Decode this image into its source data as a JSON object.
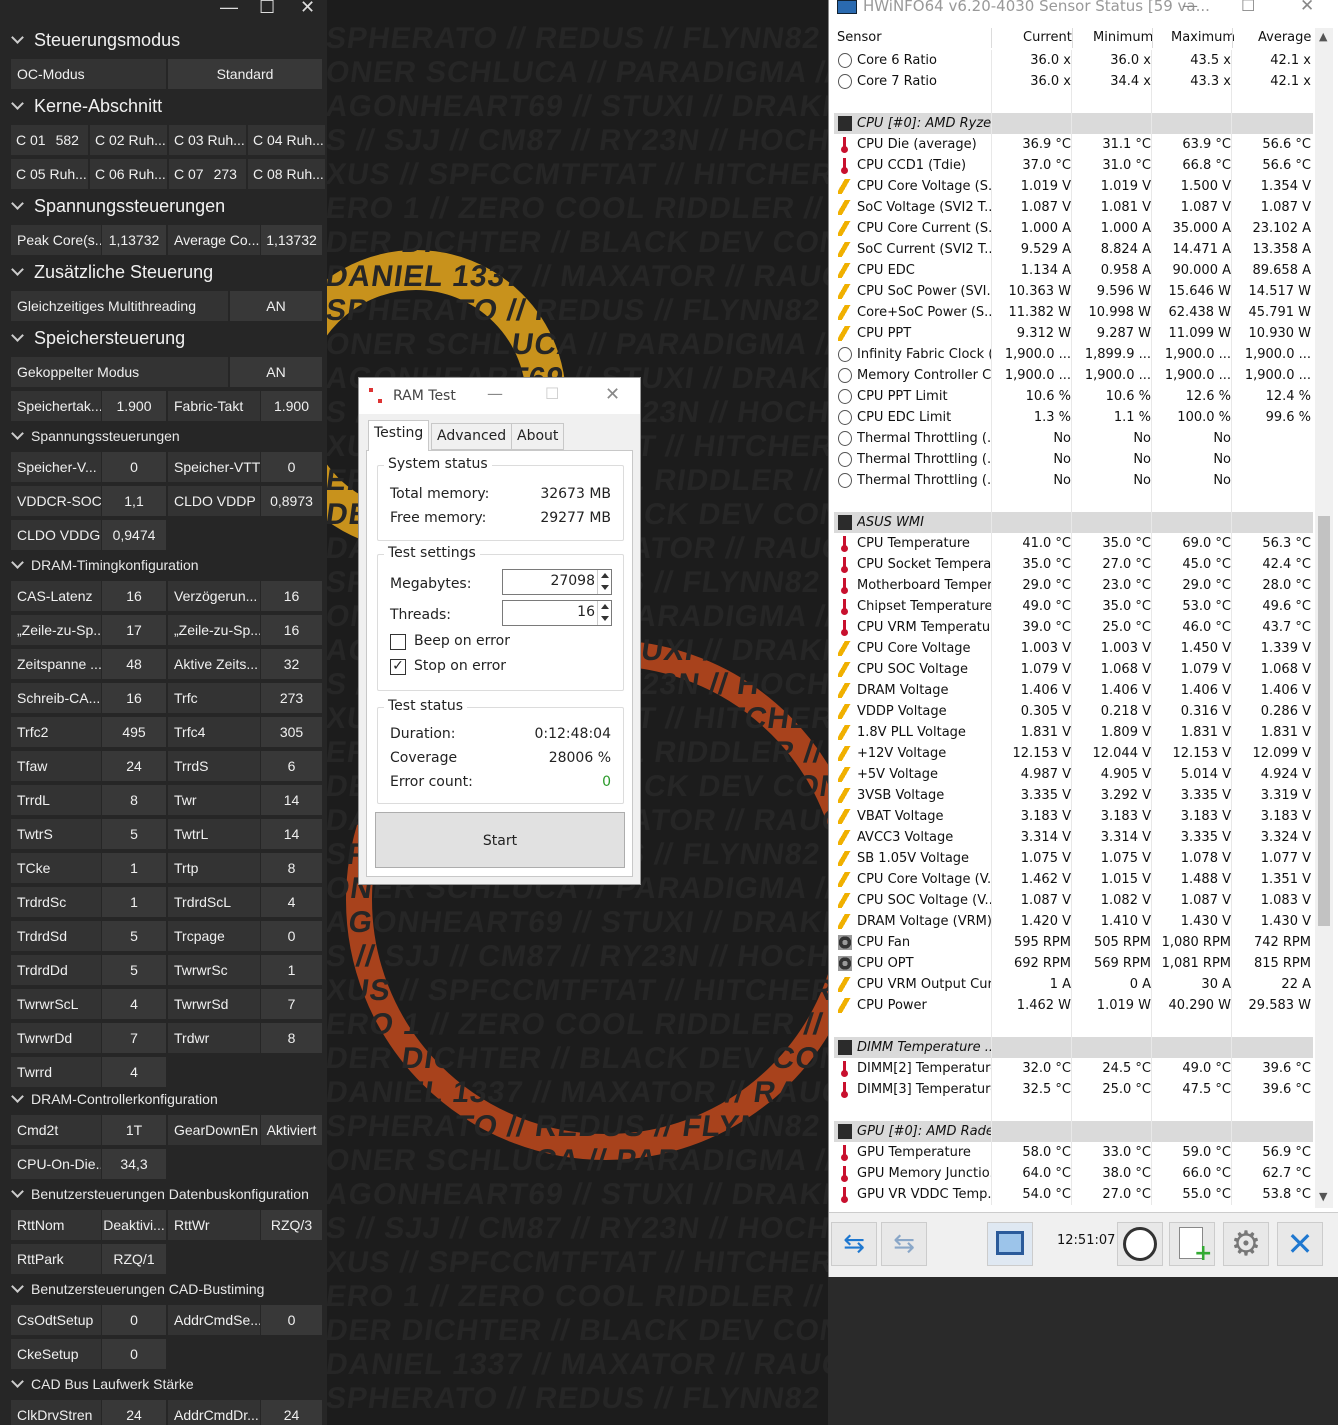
{
  "wallpaper": {
    "lines": [
      "SPHERATO // REDUS // FLYNN82 // BAAL",
      "ONER SCHLUCA // PARADIGMA // SURE",
      "AGONHEART69 // STUXI // DRAKN // KOR",
      "S // SJJ // CM87 // RY23N // HOCH",
      "XUS // SPFCCMTFTAT // HITCHER //",
      "ERO 1 // ZERO COOL RIDDLER // STING",
      "DER DICHTER // BLACK DEV CON //",
      "DANIEL 1337 // MAXATOR // RAUCH",
      "SPHERATO // REDUS // FLYNN82 // BAAL",
      "ONER SCHLUCA // PARADIGMA // SURE",
      "AGONHEART69 // STUXI // DRAKN // KOR",
      "S // SJJ // CM87 // RY23N // HOCH",
      "XUS // SPFCCMTFTAT // HITCHER //",
      "ERO 1 // ZERO COOL RIDDLER // STING",
      "DER DICHTER // BLACK DEV CON //",
      "DANIEL 1337 // MAXATOR // RAUCH",
      "SPHERATO // REDUS // FLYNN82 // BAAL",
      "ONER SCHLUCA // PARADIGMA // SURE",
      "AGONHEART69 // STUXI // DRAKN // KOR",
      "S // SJJ // CM87 // RY23N // HOCH",
      "XUS // SPFCCMTFTAT // HITCHER //",
      "ERO 1 // ZERO COOL RIDDLER // STING",
      "DER DICHTER // BLACK DEV CON //",
      "DANIEL 1337 // MAXATOR // RAUCH",
      "SPHERATO // REDUS // FLYNN82 // BAAL",
      "ONER SCHLUCA // PARADIGMA // SURE",
      "AGONHEART69 // STUXI // DRAKN // KOR",
      "S // SJJ // CM87 // RY23N // HOCH",
      "XUS // SPFCCMTFTAT // HITCHER //",
      "ERO 1 // ZERO COOL RIDDLER // STING",
      "DER DICHTER // BLACK DEV CON //",
      "DANIEL 1337 // MAXATOR // RAUCH",
      "SPHERATO // REDUS // FLYNN82 // BAAL",
      "ONER SCHLUCA // PARADIGMA // SURE",
      "AGONHEART69 // STUXI // DRAKN // KOR",
      "S // SJJ // CM87 // RY23N // HOCH",
      "XUS // SPFCCMTFTAT // HITCHER //",
      "ERO 1 // ZERO COOL RIDDLER // STING",
      "DER DICHTER // BLACK DEV CON //",
      "DANIEL 1337 // MAXATOR // RAUCH",
      "SPHERATO // REDUS // FLYNN82 // BAAL"
    ]
  },
  "ryzen": {
    "window_controls": [
      "—",
      "☐",
      "✕"
    ],
    "sections": {
      "steuerungsmodus": "Steuerungsmodus",
      "kerne": "Kerne-Abschnitt",
      "spannung": "Spannungssteuerungen",
      "zusatz": "Zusätzliche Steuerung",
      "speicher": "Speichersteuerung",
      "spannung2": "Spannungssteuerungen",
      "dram_timing": "DRAM-Timingkonfiguration",
      "dram_ctrl": "DRAM-Controllerkonfiguration",
      "datenbus": "Benutzersteuerungen Datenbuskonfiguration",
      "cad": "Benutzersteuerungen CAD-Bustiming",
      "cadbus": "CAD Bus Laufwerk Stärke"
    },
    "oc_mode": {
      "label": "OC-Modus",
      "value": "Standard"
    },
    "cores": [
      {
        "label": "C 01",
        "value": "582"
      },
      {
        "label": "C 02 Ruh...",
        "value": ""
      },
      {
        "label": "C 03 Ruh...",
        "value": ""
      },
      {
        "label": "C 04 Ruh...",
        "value": ""
      },
      {
        "label": "C 05 Ruh...",
        "value": ""
      },
      {
        "label": "C 06 Ruh...",
        "value": ""
      },
      {
        "label": "C 07",
        "value": "273"
      },
      {
        "label": "C 08 Ruh...",
        "value": ""
      }
    ],
    "voltage": [
      {
        "label": "Peak Core(s...",
        "value": "1,13732"
      },
      {
        "label": "Average Co...",
        "value": "1,13732"
      }
    ],
    "smt": {
      "label": "Gleichzeitiges Multithreading",
      "value": "AN"
    },
    "coupled": {
      "label": "Gekoppelter Modus",
      "value": "AN"
    },
    "clocks": [
      {
        "label": "Speichertak...",
        "value": "1.900"
      },
      {
        "label": "Fabric-Takt",
        "value": "1.900"
      }
    ],
    "mem_voltages": [
      {
        "label": "Speicher-V...",
        "value": "0"
      },
      {
        "label": "Speicher-VTT",
        "value": "0"
      },
      {
        "label": "VDDCR-SOC",
        "value": "1,1"
      },
      {
        "label": "CLDO VDDP",
        "value": "0,8973"
      },
      {
        "label": "CLDO VDDG",
        "value": "0,9474"
      }
    ],
    "timings": [
      {
        "label": "CAS-Latenz",
        "value": "16"
      },
      {
        "label": "Verzögerun...",
        "value": "16"
      },
      {
        "label": "„Zeile-zu-Sp...",
        "value": "17"
      },
      {
        "label": "„Zeile-zu-Sp...",
        "value": "16"
      },
      {
        "label": "Zeitspanne ...",
        "value": "48"
      },
      {
        "label": "Aktive Zeits...",
        "value": "32"
      },
      {
        "label": "Schreib-CA...",
        "value": "16"
      },
      {
        "label": "Trfc",
        "value": "273"
      },
      {
        "label": "Trfc2",
        "value": "495"
      },
      {
        "label": "Trfc4",
        "value": "305"
      },
      {
        "label": "Tfaw",
        "value": "24"
      },
      {
        "label": "TrrdS",
        "value": "6"
      },
      {
        "label": "TrrdL",
        "value": "8"
      },
      {
        "label": "Twr",
        "value": "14"
      },
      {
        "label": "TwtrS",
        "value": "5"
      },
      {
        "label": "TwtrL",
        "value": "14"
      },
      {
        "label": "TCke",
        "value": "1"
      },
      {
        "label": "Trtp",
        "value": "8"
      },
      {
        "label": "TrdrdSc",
        "value": "1"
      },
      {
        "label": "TrdrdScL",
        "value": "4"
      },
      {
        "label": "TrdrdSd",
        "value": "5"
      },
      {
        "label": "Trcpage",
        "value": "0"
      },
      {
        "label": "TrdrdDd",
        "value": "5"
      },
      {
        "label": "TwrwrSc",
        "value": "1"
      },
      {
        "label": "TwrwrScL",
        "value": "4"
      },
      {
        "label": "TwrwrSd",
        "value": "7"
      },
      {
        "label": "TwrwrDd",
        "value": "7"
      },
      {
        "label": "Trdwr",
        "value": "8"
      },
      {
        "label": "Twrrd",
        "value": "4"
      }
    ],
    "ctrl": [
      {
        "label": "Cmd2t",
        "value": "1T"
      },
      {
        "label": "GearDownEn",
        "value": "Aktiviert"
      },
      {
        "label": "CPU-On-Die...",
        "value": "34,3"
      }
    ],
    "datenbus": [
      {
        "label": "RttNom",
        "value": "Deaktivi..."
      },
      {
        "label": "RttWr",
        "value": "RZQ/3"
      },
      {
        "label": "RttPark",
        "value": "RZQ/1"
      }
    ],
    "cad": [
      {
        "label": "CsOdtSetup",
        "value": "0"
      },
      {
        "label": "AddrCmdSe...",
        "value": "0"
      },
      {
        "label": "CkeSetup",
        "value": "0"
      }
    ],
    "cadbus": [
      {
        "label": "ClkDrvStren",
        "value": "24"
      },
      {
        "label": "AddrCmdDr...",
        "value": "24"
      }
    ]
  },
  "ramtest": {
    "title": "RAM Test",
    "tabs": [
      "Testing",
      "Advanced",
      "About"
    ],
    "system_status": {
      "label": "System status",
      "total_label": "Total memory:",
      "total_value": "32673 MB",
      "free_label": "Free memory:",
      "free_value": "29277 MB"
    },
    "settings": {
      "label": "Test settings",
      "mb_label": "Megabytes:",
      "mb_value": "27098",
      "threads_label": "Threads:",
      "threads_value": "16",
      "beep_label": "Beep on error",
      "beep_checked": false,
      "stop_label": "Stop on error",
      "stop_checked": true
    },
    "status": {
      "label": "Test status",
      "duration_label": "Duration:",
      "duration_value": "0:12:48:04",
      "coverage_label": "Coverage",
      "coverage_value": "28006 %",
      "errors_label": "Error count:",
      "errors_value": "0"
    },
    "start_label": "Start",
    "error_color": "#2a9a2a"
  },
  "hwinfo": {
    "title": "HWiNFO64 v6.20-4030 Sensor Status [59 va...",
    "columns": [
      "Sensor",
      "Current",
      "Minimum",
      "Maximum",
      "Average"
    ],
    "time": "12:51:07",
    "rows": [
      {
        "type": "clock",
        "name": "Core 6 Ratio",
        "cur": "36.0 x",
        "min": "36.0 x",
        "max": "43.5 x",
        "avg": "42.1 x"
      },
      {
        "type": "clock",
        "name": "Core 7 Ratio",
        "cur": "36.0 x",
        "min": "34.4 x",
        "max": "43.3 x",
        "avg": "42.1 x"
      },
      {
        "type": "blank"
      },
      {
        "type": "group",
        "name": "CPU [#0]: AMD Ryze..."
      },
      {
        "type": "therm",
        "name": "CPU Die (average)",
        "cur": "36.9 °C",
        "min": "31.1 °C",
        "max": "63.9 °C",
        "avg": "56.6 °C"
      },
      {
        "type": "therm",
        "name": "CPU CCD1 (Tdie)",
        "cur": "37.0 °C",
        "min": "31.0 °C",
        "max": "66.8 °C",
        "avg": "56.6 °C"
      },
      {
        "type": "volt",
        "name": "CPU Core Voltage (S...",
        "cur": "1.019 V",
        "min": "1.019 V",
        "max": "1.500 V",
        "avg": "1.354 V"
      },
      {
        "type": "volt",
        "name": "SoC Voltage (SVI2 T...",
        "cur": "1.087 V",
        "min": "1.081 V",
        "max": "1.087 V",
        "avg": "1.087 V"
      },
      {
        "type": "volt",
        "name": "CPU Core Current (S...",
        "cur": "1.000 A",
        "min": "1.000 A",
        "max": "35.000 A",
        "avg": "23.102 A"
      },
      {
        "type": "volt",
        "name": "SoC Current (SVI2 T...",
        "cur": "9.529 A",
        "min": "8.824 A",
        "max": "14.471 A",
        "avg": "13.358 A"
      },
      {
        "type": "volt",
        "name": "CPU EDC",
        "cur": "1.134 A",
        "min": "0.958 A",
        "max": "90.000 A",
        "avg": "89.658 A"
      },
      {
        "type": "volt",
        "name": "CPU SoC Power (SVI...",
        "cur": "10.363 W",
        "min": "9.596 W",
        "max": "15.646 W",
        "avg": "14.517 W"
      },
      {
        "type": "volt",
        "name": "Core+SoC Power (S...",
        "cur": "11.382 W",
        "min": "10.998 W",
        "max": "62.438 W",
        "avg": "45.791 W"
      },
      {
        "type": "volt",
        "name": "CPU PPT",
        "cur": "9.312 W",
        "min": "9.287 W",
        "max": "11.099 W",
        "avg": "10.930 W"
      },
      {
        "type": "clock",
        "name": "Infinity Fabric Clock (...",
        "cur": "1,900.0 ...",
        "min": "1,899.9 ...",
        "max": "1,900.0 ...",
        "avg": "1,900.0 ..."
      },
      {
        "type": "clock",
        "name": "Memory Controller Cl...",
        "cur": "1,900.0 ...",
        "min": "1,900.0 ...",
        "max": "1,900.0 ...",
        "avg": "1,900.0 ..."
      },
      {
        "type": "clock",
        "name": "CPU PPT Limit",
        "cur": "10.6 %",
        "min": "10.6 %",
        "max": "12.6 %",
        "avg": "12.4 %"
      },
      {
        "type": "clock",
        "name": "CPU EDC Limit",
        "cur": "1.3 %",
        "min": "1.1 %",
        "max": "100.0 %",
        "avg": "99.6 %"
      },
      {
        "type": "clock",
        "name": "Thermal Throttling (...",
        "cur": "No",
        "min": "No",
        "max": "No",
        "avg": ""
      },
      {
        "type": "clock",
        "name": "Thermal Throttling (...",
        "cur": "No",
        "min": "No",
        "max": "No",
        "avg": ""
      },
      {
        "type": "clock",
        "name": "Thermal Throttling (...",
        "cur": "No",
        "min": "No",
        "max": "No",
        "avg": ""
      },
      {
        "type": "blank"
      },
      {
        "type": "group",
        "name": "ASUS WMI"
      },
      {
        "type": "therm",
        "name": "CPU Temperature",
        "cur": "41.0 °C",
        "min": "35.0 °C",
        "max": "69.0 °C",
        "avg": "56.3 °C"
      },
      {
        "type": "therm",
        "name": "CPU Socket Tempera...",
        "cur": "35.0 °C",
        "min": "27.0 °C",
        "max": "45.0 °C",
        "avg": "42.4 °C"
      },
      {
        "type": "therm",
        "name": "Motherboard Temper...",
        "cur": "29.0 °C",
        "min": "23.0 °C",
        "max": "29.0 °C",
        "avg": "28.0 °C"
      },
      {
        "type": "therm",
        "name": "Chipset Temperature",
        "cur": "49.0 °C",
        "min": "35.0 °C",
        "max": "53.0 °C",
        "avg": "49.6 °C"
      },
      {
        "type": "therm",
        "name": "CPU VRM Temperature",
        "cur": "39.0 °C",
        "min": "25.0 °C",
        "max": "46.0 °C",
        "avg": "43.7 °C"
      },
      {
        "type": "volt",
        "name": "CPU Core Voltage",
        "cur": "1.003 V",
        "min": "1.003 V",
        "max": "1.450 V",
        "avg": "1.339 V"
      },
      {
        "type": "volt",
        "name": "CPU SOC Voltage",
        "cur": "1.079 V",
        "min": "1.068 V",
        "max": "1.079 V",
        "avg": "1.068 V"
      },
      {
        "type": "volt",
        "name": "DRAM Voltage",
        "cur": "1.406 V",
        "min": "1.406 V",
        "max": "1.406 V",
        "avg": "1.406 V"
      },
      {
        "type": "volt",
        "name": "VDDP Voltage",
        "cur": "0.305 V",
        "min": "0.218 V",
        "max": "0.316 V",
        "avg": "0.286 V"
      },
      {
        "type": "volt",
        "name": "1.8V PLL Voltage",
        "cur": "1.831 V",
        "min": "1.809 V",
        "max": "1.831 V",
        "avg": "1.831 V"
      },
      {
        "type": "volt",
        "name": "+12V Voltage",
        "cur": "12.153 V",
        "min": "12.044 V",
        "max": "12.153 V",
        "avg": "12.099 V"
      },
      {
        "type": "volt",
        "name": "+5V Voltage",
        "cur": "4.987 V",
        "min": "4.905 V",
        "max": "5.014 V",
        "avg": "4.924 V"
      },
      {
        "type": "volt",
        "name": "3VSB Voltage",
        "cur": "3.335 V",
        "min": "3.292 V",
        "max": "3.335 V",
        "avg": "3.319 V"
      },
      {
        "type": "volt",
        "name": "VBAT Voltage",
        "cur": "3.183 V",
        "min": "3.183 V",
        "max": "3.183 V",
        "avg": "3.183 V"
      },
      {
        "type": "volt",
        "name": "AVCC3 Voltage",
        "cur": "3.314 V",
        "min": "3.314 V",
        "max": "3.335 V",
        "avg": "3.324 V"
      },
      {
        "type": "volt",
        "name": "SB 1.05V Voltage",
        "cur": "1.075 V",
        "min": "1.075 V",
        "max": "1.078 V",
        "avg": "1.077 V"
      },
      {
        "type": "volt",
        "name": "CPU Core Voltage (V...",
        "cur": "1.462 V",
        "min": "1.015 V",
        "max": "1.488 V",
        "avg": "1.351 V"
      },
      {
        "type": "volt",
        "name": "CPU SOC Voltage (V...",
        "cur": "1.087 V",
        "min": "1.082 V",
        "max": "1.087 V",
        "avg": "1.083 V"
      },
      {
        "type": "volt",
        "name": "DRAM Voltage (VRM)",
        "cur": "1.420 V",
        "min": "1.410 V",
        "max": "1.430 V",
        "avg": "1.430 V"
      },
      {
        "type": "fan",
        "name": "CPU Fan",
        "cur": "595 RPM",
        "min": "505 RPM",
        "max": "1,080 RPM",
        "avg": "742 RPM"
      },
      {
        "type": "fan",
        "name": "CPU OPT",
        "cur": "692 RPM",
        "min": "569 RPM",
        "max": "1,081 RPM",
        "avg": "815 RPM"
      },
      {
        "type": "volt",
        "name": "CPU VRM Output Cur...",
        "cur": "1 A",
        "min": "0 A",
        "max": "30 A",
        "avg": "22 A"
      },
      {
        "type": "volt",
        "name": "CPU Power",
        "cur": "1.462 W",
        "min": "1.019 W",
        "max": "40.290 W",
        "avg": "29.583 W"
      },
      {
        "type": "blank"
      },
      {
        "type": "group",
        "name": "DIMM Temperature ..."
      },
      {
        "type": "therm",
        "name": "DIMM[2] Temperature",
        "cur": "32.0 °C",
        "min": "24.5 °C",
        "max": "49.0 °C",
        "avg": "39.6 °C"
      },
      {
        "type": "therm",
        "name": "DIMM[3] Temperature",
        "cur": "32.5 °C",
        "min": "25.0 °C",
        "max": "47.5 °C",
        "avg": "39.6 °C"
      },
      {
        "type": "blank"
      },
      {
        "type": "group",
        "name": "GPU [#0]: AMD Rade..."
      },
      {
        "type": "therm",
        "name": "GPU Temperature",
        "cur": "58.0 °C",
        "min": "33.0 °C",
        "max": "59.0 °C",
        "avg": "56.9 °C"
      },
      {
        "type": "therm",
        "name": "GPU Memory Junctio...",
        "cur": "64.0 °C",
        "min": "38.0 °C",
        "max": "66.0 °C",
        "avg": "62.7 °C"
      },
      {
        "type": "therm",
        "name": "GPU VR VDDC Temp...",
        "cur": "54.0 °C",
        "min": "27.0 °C",
        "max": "55.0 °C",
        "avg": "53.8 °C"
      }
    ]
  }
}
